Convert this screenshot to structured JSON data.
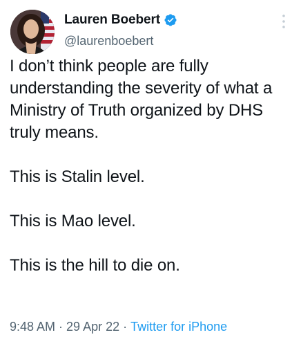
{
  "author": {
    "display_name": "Lauren Boebert",
    "handle": "@laurenboebert",
    "verified": true,
    "verified_color": "#1d9bf0"
  },
  "tweet": {
    "paragraphs": [
      "I don’t think people are fully understanding the severity of what a Ministry of Truth organized by DHS truly means.",
      "This is Stalin level.",
      "This is Mao level.",
      "This is the hill to die on."
    ]
  },
  "meta": {
    "time": "9:48 AM",
    "date": "29 Apr 22",
    "separator": "·",
    "source": "Twitter for iPhone"
  },
  "icons": {
    "avatar": "profile-photo",
    "verified": "verified-badge-icon",
    "more": "more-options-icon"
  }
}
